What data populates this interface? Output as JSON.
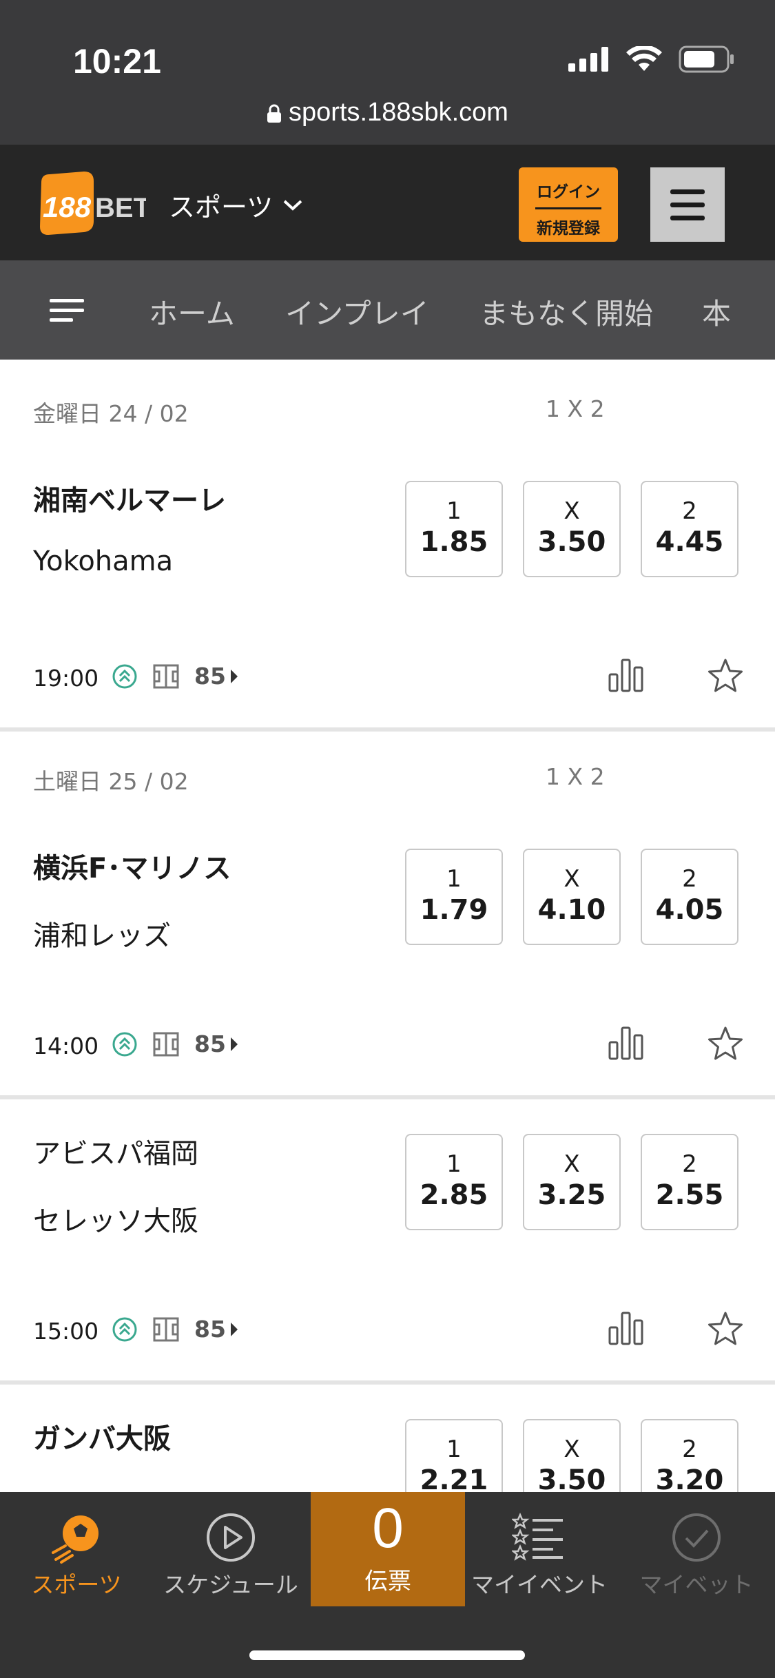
{
  "status": {
    "time": "10:21",
    "url": "sports.188sbk.com"
  },
  "header": {
    "logo_text": "188BET",
    "sport_select": "スポーツ",
    "login": "ログイン",
    "register": "新規登録"
  },
  "nav": {
    "items": [
      "ホーム",
      "インプレイ",
      "まもなく開始",
      "本"
    ]
  },
  "sections": [
    {
      "date": "金曜日 24 / 02",
      "market": "1 X 2"
    },
    {
      "date": "土曜日 25 / 02",
      "market": "1 X 2"
    }
  ],
  "matches": [
    {
      "home": "湘南ベルマーレ",
      "away": "Yokohama",
      "time": "19:00",
      "markets": "85",
      "odds": [
        {
          "label": "1",
          "value": "1.85"
        },
        {
          "label": "X",
          "value": "3.50"
        },
        {
          "label": "2",
          "value": "4.45"
        }
      ]
    },
    {
      "home": "横浜F･マリノス",
      "away": "浦和レッズ",
      "time": "14:00",
      "markets": "85",
      "odds": [
        {
          "label": "1",
          "value": "1.79"
        },
        {
          "label": "X",
          "value": "4.10"
        },
        {
          "label": "2",
          "value": "4.05"
        }
      ]
    },
    {
      "home": "アビスパ福岡",
      "away": "セレッソ大阪",
      "time": "15:00",
      "markets": "85",
      "odds": [
        {
          "label": "1",
          "value": "2.85"
        },
        {
          "label": "X",
          "value": "3.25"
        },
        {
          "label": "2",
          "value": "2.55"
        }
      ]
    },
    {
      "home": "ガンバ大阪",
      "away": "",
      "odds": [
        {
          "label": "1",
          "value": "2.21"
        },
        {
          "label": "X",
          "value": "3.50"
        },
        {
          "label": "2",
          "value": "3.20"
        }
      ]
    }
  ],
  "tabbar": {
    "sports": "スポーツ",
    "schedule": "スケジュール",
    "betslip_count": "0",
    "betslip": "伝票",
    "my_events": "マイイベント",
    "my_bets": "マイベット"
  },
  "colors": {
    "accent": "#f7941d",
    "header": "#262626",
    "nav": "#4b4b4d",
    "tabbar": "#333333",
    "betslip": "#b26a12"
  }
}
